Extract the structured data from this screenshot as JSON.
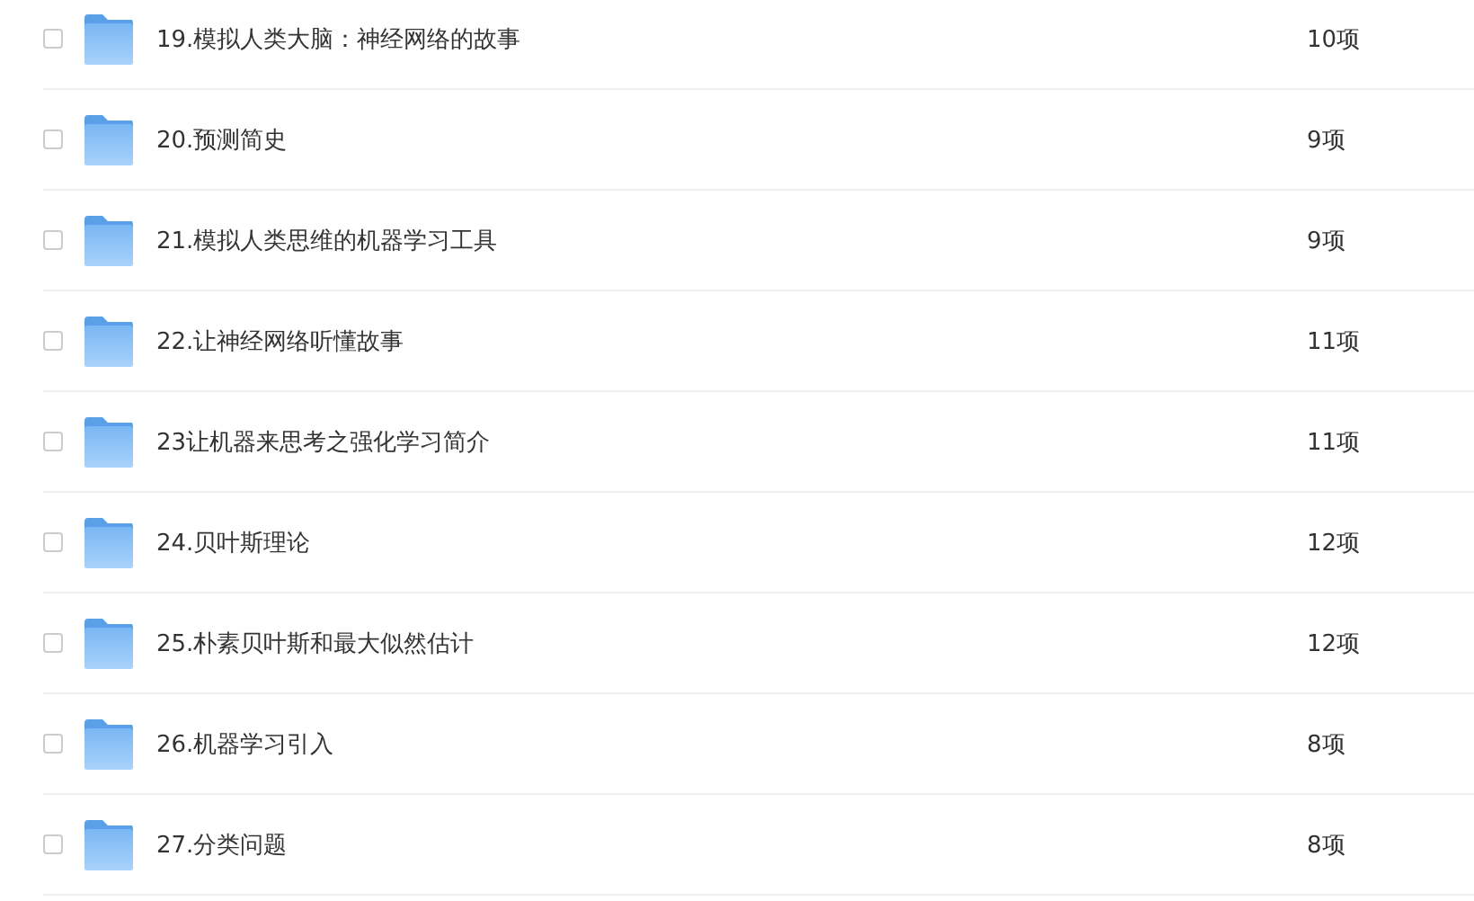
{
  "files": [
    {
      "name": "19.模拟人类大脑：神经网络的故事",
      "count": "10项",
      "checked": false
    },
    {
      "name": "20.预测简史",
      "count": "9项",
      "checked": false
    },
    {
      "name": "21.模拟人类思维的机器学习工具",
      "count": "9项",
      "checked": false
    },
    {
      "name": "22.让神经网络听懂故事",
      "count": "11项",
      "checked": false
    },
    {
      "name": "23让机器来思考之强化学习简介",
      "count": "11项",
      "checked": false
    },
    {
      "name": "24.贝叶斯理论",
      "count": "12项",
      "checked": false
    },
    {
      "name": "25.朴素贝叶斯和最大似然估计",
      "count": "12项",
      "checked": false
    },
    {
      "name": "26.机器学习引入",
      "count": "8项",
      "checked": false
    },
    {
      "name": "27.分类问题",
      "count": "8项",
      "checked": false
    }
  ]
}
